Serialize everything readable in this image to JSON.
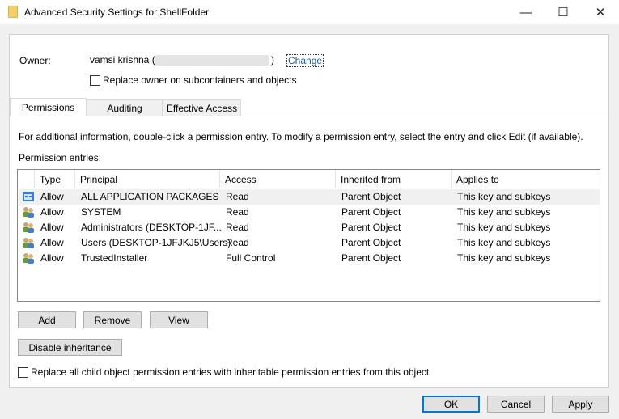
{
  "window": {
    "title": "Advanced Security Settings for ShellFolder",
    "minimize": "—",
    "maximize": "☐",
    "close": "✕"
  },
  "owner": {
    "label": "Owner:",
    "name_prefix": "vamsi krishna (",
    "name_suffix": ")",
    "change_link": "Change",
    "replace_checkbox": "Replace owner on subcontainers and objects"
  },
  "tabs": [
    {
      "label": "Permissions"
    },
    {
      "label": "Auditing"
    },
    {
      "label": "Effective Access"
    }
  ],
  "info_text": "For additional information, double-click a permission entry. To modify a permission entry, select the entry and click Edit (if available).",
  "entries_label": "Permission entries:",
  "columns": [
    "Type",
    "Principal",
    "Access",
    "Inherited from",
    "Applies to"
  ],
  "rows": [
    {
      "icon": "app-packages-icon",
      "type": "Allow",
      "principal": "ALL APPLICATION PACKAGES",
      "access": "Read",
      "inherited": "Parent Object",
      "applies": "This key and subkeys"
    },
    {
      "icon": "users-icon",
      "type": "Allow",
      "principal": "SYSTEM",
      "access": "Read",
      "inherited": "Parent Object",
      "applies": "This key and subkeys"
    },
    {
      "icon": "users-icon",
      "type": "Allow",
      "principal": "Administrators (DESKTOP-1JF...",
      "access": "Read",
      "inherited": "Parent Object",
      "applies": "This key and subkeys"
    },
    {
      "icon": "users-icon",
      "type": "Allow",
      "principal": "Users (DESKTOP-1JFJKJ5\\Users)",
      "access": "Read",
      "inherited": "Parent Object",
      "applies": "This key and subkeys"
    },
    {
      "icon": "users-icon",
      "type": "Allow",
      "principal": "TrustedInstaller",
      "access": "Full Control",
      "inherited": "Parent Object",
      "applies": "This key and subkeys"
    }
  ],
  "buttons": {
    "add": "Add",
    "remove": "Remove",
    "view": "View",
    "disable_inheritance": "Disable inheritance",
    "ok": "OK",
    "cancel": "Cancel",
    "apply": "Apply"
  },
  "replace_child_checkbox": "Replace all child object permission entries with inheritable permission entries from this object"
}
